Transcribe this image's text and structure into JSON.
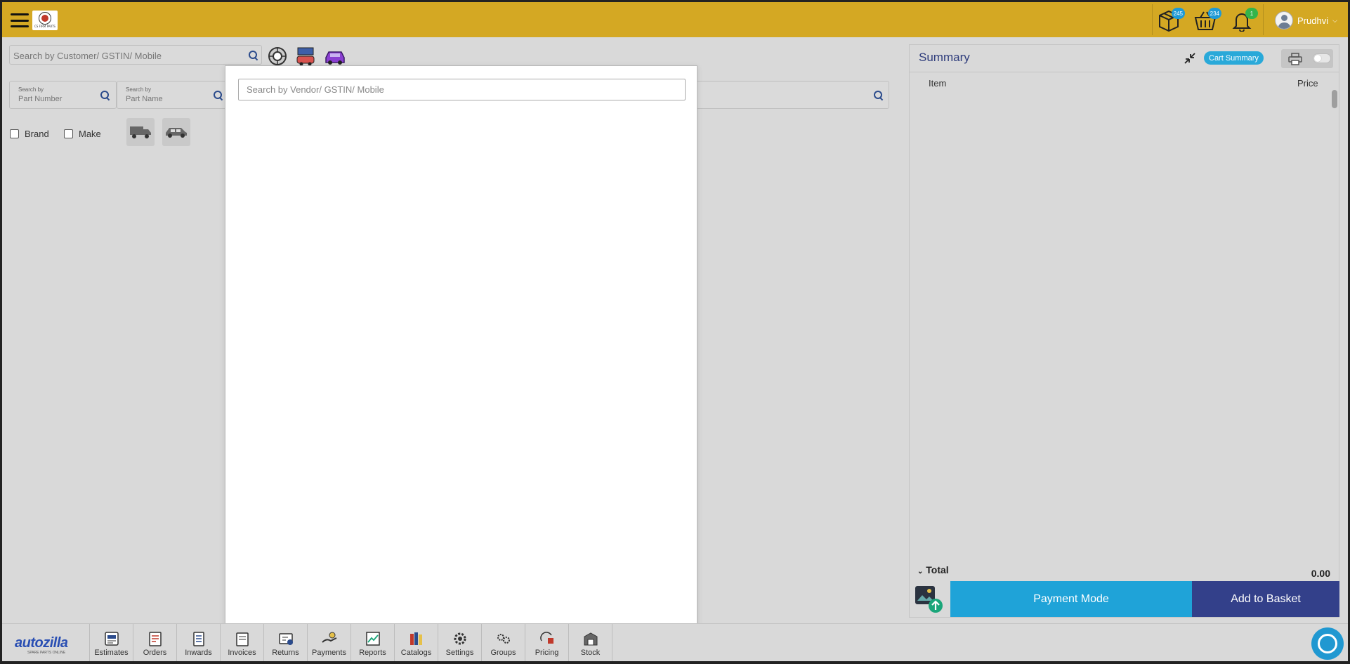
{
  "header": {
    "logo_text": "CS FIRM PARTS",
    "badges": {
      "packages": "245",
      "basket": "234",
      "notifications": "1"
    },
    "user_name": "Prudhvi"
  },
  "search": {
    "customer_placeholder": "Search by Customer/ GSTIN/ Mobile",
    "part_number_label": "Search by",
    "part_number_value": "Part Number",
    "part_name_label": "Search by",
    "part_name_value": "Part Name"
  },
  "filters": {
    "brand": "Brand",
    "make": "Make"
  },
  "modal": {
    "vendor_placeholder": "Search by Vendor/ GSTIN/ Mobile"
  },
  "summary": {
    "title": "Summary",
    "cart_summary": "Cart Summary",
    "col_item": "Item",
    "col_price": "Price",
    "total_label": "Total",
    "total_value": "0.00",
    "payment_mode": "Payment Mode",
    "add_to_basket": "Add to Basket"
  },
  "footer": {
    "brand": "autozilla",
    "brand_sub": "SPARE PARTS ONLINE",
    "nav": [
      "Estimates",
      "Orders",
      "Inwards",
      "Invoices",
      "Returns",
      "Payments",
      "Reports",
      "Catalogs",
      "Settings",
      "Groups",
      "Pricing",
      "Stock"
    ]
  },
  "colors": {
    "topbar": "#d4a823",
    "accent_blue": "#1fa3d8",
    "basket_navy": "#33408a",
    "title_navy": "#2f3d7c"
  }
}
